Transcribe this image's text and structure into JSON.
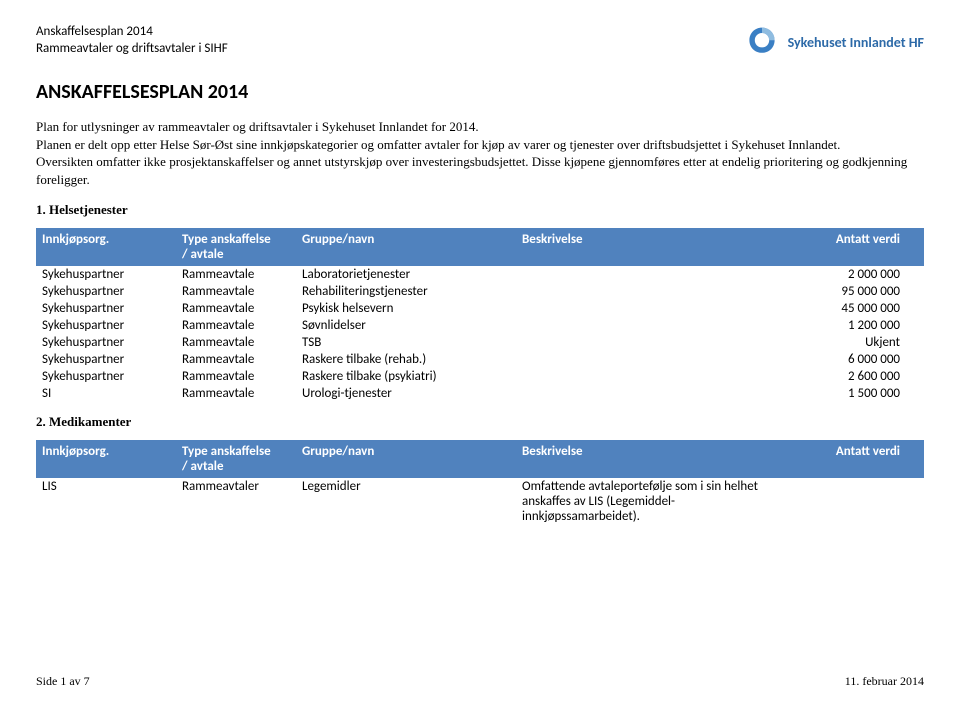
{
  "header": {
    "line1": "Anskaffelsesplan 2014",
    "line2": "Rammeavtaler og driftsavtaler i SIHF",
    "logo_text": "Sykehuset Innlandet HF"
  },
  "title": "ANSKAFFELSESPLAN 2014",
  "intro": {
    "p1": "Plan for utlysninger av rammeavtaler og driftsavtaler i Sykehuset Innlandet for 2014.",
    "p2": "Planen er delt opp etter Helse Sør-Øst sine innkjøpskategorier og omfatter avtaler for kjøp av varer og tjenester over driftsbudsjettet i Sykehuset Innlandet.",
    "p3": "Oversikten omfatter ikke prosjektanskaffelser og annet utstyrskjøp over investeringsbudsjettet. Disse kjøpene gjennomføres etter at endelig prioritering og godkjenning foreligger."
  },
  "section1": {
    "heading": "1. Helsetjenester",
    "cols": {
      "org": "Innkjøpsorg.",
      "type_l1": "Type anskaffelse",
      "type_l2": "/ avtale",
      "group": "Gruppe/navn",
      "desc": "Beskrivelse",
      "val": "Antatt verdi"
    },
    "rows": [
      {
        "org": "Sykehuspartner",
        "type": "Rammeavtale",
        "group": "Laboratorietjenester",
        "desc": "",
        "val": "2 000 000"
      },
      {
        "org": "Sykehuspartner",
        "type": "Rammeavtale",
        "group": "Rehabiliteringstjenester",
        "desc": "",
        "val": "95 000 000"
      },
      {
        "org": "Sykehuspartner",
        "type": "Rammeavtale",
        "group": "Psykisk helsevern",
        "desc": "",
        "val": "45 000 000"
      },
      {
        "org": "Sykehuspartner",
        "type": "Rammeavtale",
        "group": "Søvnlidelser",
        "desc": "",
        "val": "1 200 000"
      },
      {
        "org": "Sykehuspartner",
        "type": "Rammeavtale",
        "group": "TSB",
        "desc": "",
        "val": "Ukjent"
      },
      {
        "org": "Sykehuspartner",
        "type": "Rammeavtale",
        "group": "Raskere tilbake (rehab.)",
        "desc": "",
        "val": "6 000 000"
      },
      {
        "org": "Sykehuspartner",
        "type": "Rammeavtale",
        "group": "Raskere tilbake (psykiatri)",
        "desc": "",
        "val": "2 600 000"
      },
      {
        "org": "SI",
        "type": "Rammeavtale",
        "group": "Urologi-tjenester",
        "desc": "",
        "val": "1 500 000"
      }
    ]
  },
  "section2": {
    "heading": "2. Medikamenter",
    "cols": {
      "org": "Innkjøpsorg.",
      "type_l1": "Type anskaffelse",
      "type_l2": "/ avtale",
      "group": "Gruppe/navn",
      "desc": "Beskrivelse",
      "val": "Antatt verdi"
    },
    "rows": [
      {
        "org": "LIS",
        "type": "Rammeavtaler",
        "group": "Legemidler",
        "desc": "Omfattende avtaleportefølje som i sin helhet anskaffes av LIS (Legemiddel-innkjøpssamarbeidet).",
        "val": ""
      }
    ]
  },
  "footer": {
    "left": "Side 1 av 7",
    "right": "11. februar 2014"
  },
  "chart_data": {
    "type": "table",
    "title": "Anskaffelsesplan 2014 – Helsetjenester",
    "columns": [
      "Innkjøpsorg.",
      "Type anskaffelse / avtale",
      "Gruppe/navn",
      "Beskrivelse",
      "Antatt verdi"
    ],
    "rows": [
      [
        "Sykehuspartner",
        "Rammeavtale",
        "Laboratorietjenester",
        "",
        2000000
      ],
      [
        "Sykehuspartner",
        "Rammeavtale",
        "Rehabiliteringstjenester",
        "",
        95000000
      ],
      [
        "Sykehuspartner",
        "Rammeavtale",
        "Psykisk helsevern",
        "",
        45000000
      ],
      [
        "Sykehuspartner",
        "Rammeavtale",
        "Søvnlidelser",
        "",
        1200000
      ],
      [
        "Sykehuspartner",
        "Rammeavtale",
        "TSB",
        "",
        null
      ],
      [
        "Sykehuspartner",
        "Rammeavtale",
        "Raskere tilbake (rehab.)",
        "",
        6000000
      ],
      [
        "Sykehuspartner",
        "Rammeavtale",
        "Raskere tilbake (psykiatri)",
        "",
        2600000
      ],
      [
        "SI",
        "Rammeavtale",
        "Urologi-tjenester",
        "",
        1500000
      ]
    ]
  }
}
